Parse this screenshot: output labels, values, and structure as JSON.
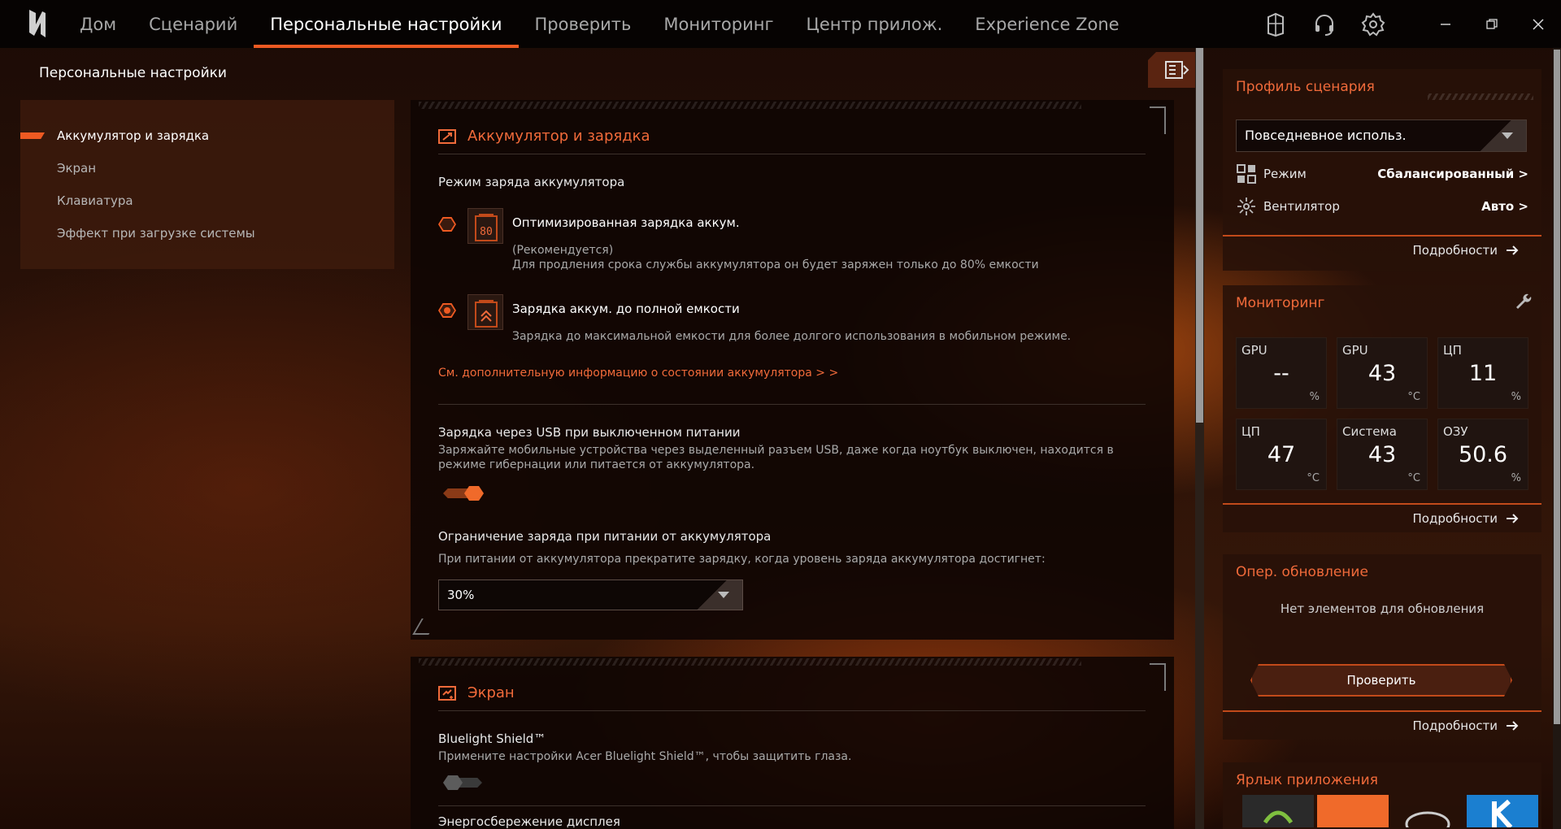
{
  "nav": {
    "items": [
      "Дом",
      "Сценарий",
      "Персональные настройки",
      "Проверить",
      "Мониторинг",
      "Центр прилож.",
      "Experience Zone"
    ],
    "active": 2
  },
  "page": {
    "title": "Персональные настройки"
  },
  "subnav": [
    "Аккумулятор и зарядка",
    "Экран",
    "Клавиатура",
    "Эффект при загрузке системы"
  ],
  "battery": {
    "section_title": "Аккумулятор и зарядка",
    "mode_label": "Режим заряда аккумулятора",
    "opt1": {
      "title": "Оптимизированная зарядка аккум.",
      "sub": "(Рекомендуется)",
      "desc": "Для продления срока службы аккумулятора он будет заряжен только до 80% емкости",
      "badge": "80"
    },
    "opt2": {
      "title": "Зарядка аккум. до полной емкости",
      "desc": "Зарядка до максимальной емкости для более долгого использования в мобильном режиме."
    },
    "link": "См. дополнительную информацию о состоянии аккумулятора > >",
    "usb": {
      "title": "Зарядка через USB при выключенном питании",
      "desc": "Заряжайте мобильные устройства через выделенный разъем USB, даже когда ноутбук выключен, находится в режиме гибернации или питается от аккумулятора."
    },
    "limit": {
      "title": "Ограничение заряда при питании от аккумулятора",
      "desc": "При питании от аккумулятора прекратите зарядку, когда уровень заряда аккумулятора достигнет:",
      "value": "30%"
    }
  },
  "screen": {
    "section_title": "Экран",
    "bluelight": {
      "title": "Bluelight Shield™",
      "desc": "Примените настройки Acer Bluelight Shield™, чтобы защитить глаза."
    },
    "power": {
      "title": "Энергосбережение дисплея"
    }
  },
  "profile": {
    "title": "Профиль сценария",
    "value": "Повседневное использ.",
    "mode_label": "Режим",
    "mode_value": "Сбалансированный >",
    "fan_label": "Вентилятор",
    "fan_value": "Авто >",
    "more": "Подробности"
  },
  "monitoring": {
    "title": "Мониторинг",
    "more": "Подробности",
    "tiles": [
      {
        "label": "GPU",
        "value": "--",
        "unit": "%"
      },
      {
        "label": "GPU",
        "value": "43",
        "unit": "°C"
      },
      {
        "label": "ЦП",
        "value": "11",
        "unit": "%"
      },
      {
        "label": "ЦП",
        "value": "47",
        "unit": "°C"
      },
      {
        "label": "Система",
        "value": "43",
        "unit": "°C"
      },
      {
        "label": "ОЗУ",
        "value": "50.6",
        "unit": "%"
      }
    ]
  },
  "update": {
    "title": "Опер. обновление",
    "status": "Нет элементов для обновления",
    "button": "Проверить",
    "more": "Подробности"
  },
  "shortcuts": {
    "title": "Ярлык приложения"
  },
  "colors": {
    "accent": "#ee5a22",
    "accent_text": "#f06a3a"
  }
}
